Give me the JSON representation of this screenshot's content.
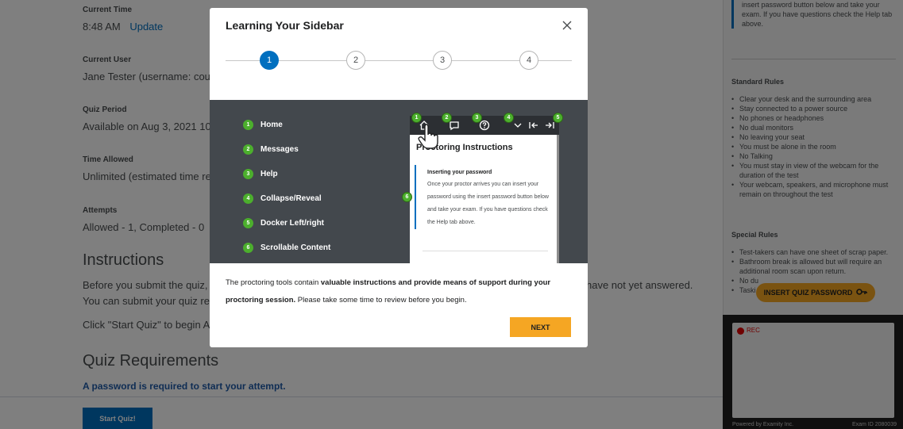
{
  "page": {
    "current_time": {
      "label": "Current Time",
      "value": "8:48 AM",
      "update_link": "Update"
    },
    "current_user": {
      "label": "Current User",
      "value": "Jane Tester (username: cour"
    },
    "quiz_period": {
      "label": "Quiz Period",
      "value": "Available on Aug 3, 2021 10"
    },
    "time_allowed": {
      "label": "Time Allowed",
      "value": "Unlimited (estimated time re"
    },
    "attempts": {
      "label": "Attempts",
      "value": "Allowed - 1, Completed - 0"
    },
    "instructions_heading": "Instructions",
    "instructions_line1_left": "Before you submit the quiz,",
    "instructions_line1_right": "have not yet answered.",
    "instructions_line2": "You can submit your quiz re",
    "instructions_line3": "Click \"Start Quiz\" to begin A",
    "requirements_heading": "Quiz Requirements",
    "password_required": "A password is required to start your attempt.",
    "start_button": "Start Quiz!"
  },
  "sidebar": {
    "top_text": "insert password button below and take your exam. If you have questions check the Help tab above.",
    "standard_rules_heading": "Standard Rules",
    "standard_rules": [
      "Clear your desk and the surrounding area",
      "Stay connected to a power source",
      "No phones or headphones",
      "No dual monitors",
      "No leaving your seat",
      "You must be alone in the room",
      "No Talking",
      "You must stay in view of the webcam for the duration of the test",
      "Your webcam, speakers, and microphone must remain on throughout the test"
    ],
    "special_rules_heading": "Special Rules",
    "special_rules": [
      "Test-takers can have one sheet of scrap paper.",
      "Bathroom break is allowed but will require an additional room scan upon return.",
      "No du",
      "Taski"
    ],
    "insert_button": "INSERT QUIZ PASSWORD",
    "recording_label": "REC",
    "footer_left": "Powered by Examity Inc.",
    "footer_right": "Exam ID 2080039",
    "accent_color": "#006fbf"
  },
  "modal": {
    "title": "Learning Your Sidebar",
    "close_icon": "close-icon",
    "steps": [
      "1",
      "2",
      "3",
      "4"
    ],
    "active_step": 1,
    "legend": [
      {
        "num": "1",
        "label": "Home"
      },
      {
        "num": "2",
        "label": "Messages"
      },
      {
        "num": "3",
        "label": "Help"
      },
      {
        "num": "4",
        "label": "Collapse/Reveal"
      },
      {
        "num": "5",
        "label": "Docker Left/right"
      },
      {
        "num": "6",
        "label": "Scrollable Content"
      }
    ],
    "preview": {
      "title": "Proctoring Instructions",
      "subtitle": "Inserting your password",
      "body": "Once your proctor arrives you can insert your password using the insert password button below and take your exam. If you have questions check the Help tab above."
    },
    "description_part1": "The proctoring tools contain ",
    "description_bold1": "valuable instructions and provide means of support during your proctoring session.",
    "description_part2": " Please take some time to review before you begin.",
    "next_button": "NEXT",
    "accent_color": "#006fbf",
    "badge_color": "#4caf2d",
    "button_color": "#f5a623"
  }
}
